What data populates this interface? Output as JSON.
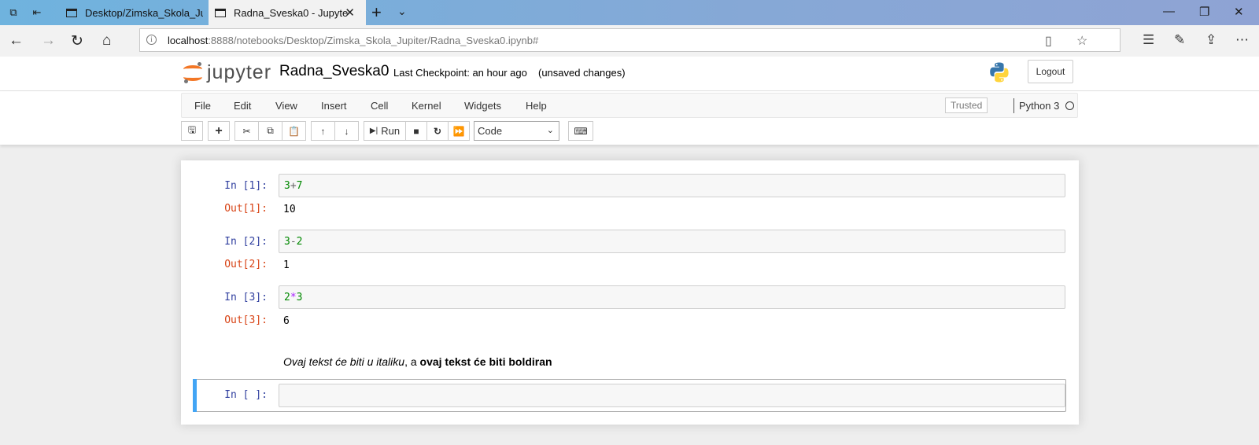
{
  "browser": {
    "tabs": [
      {
        "title": "Desktop/Zimska_Skola_Jupi",
        "active": false
      },
      {
        "title": "Radna_Sveska0 - Jupyte",
        "active": true
      }
    ],
    "url_host": "localhost",
    "url_rest": ":8888/notebooks/Desktop/Zimska_Skola_Jupiter/Radna_Sveska0.ipynb#"
  },
  "header": {
    "logo_text": "jupyter",
    "notebook_name": "Radna_Sveska0",
    "checkpoint": "Last Checkpoint: an hour ago",
    "autosave": "(unsaved changes)",
    "logout_label": "Logout"
  },
  "menubar": {
    "items": [
      "File",
      "Edit",
      "View",
      "Insert",
      "Cell",
      "Kernel",
      "Widgets",
      "Help"
    ],
    "trusted": "Trusted",
    "kernel": "Python 3"
  },
  "toolbar": {
    "run_label": "Run",
    "cell_type": "Code"
  },
  "cells": [
    {
      "in_prompt": "In [1]:",
      "code": [
        "3",
        "+",
        "7"
      ],
      "out_prompt": "Out[1]:",
      "output": "10"
    },
    {
      "in_prompt": "In [2]:",
      "code": [
        "3",
        "-",
        "2"
      ],
      "out_prompt": "Out[2]:",
      "output": "1"
    },
    {
      "in_prompt": "In [3]:",
      "code": [
        "2",
        "*",
        "3"
      ],
      "out_prompt": "Out[3]:",
      "output": "6"
    }
  ],
  "markdown": {
    "italic": "Ovaj tekst će biti u italiku",
    "middle": ", a ",
    "bold": "ovaj tekst će biti boldiran"
  },
  "empty_cell": {
    "in_prompt": "In [ ]:"
  },
  "colors": {
    "accent": "#42a5f5",
    "in_prompt": "#303f9f",
    "out_prompt": "#d84315",
    "jupyter_orange": "#f37726"
  }
}
